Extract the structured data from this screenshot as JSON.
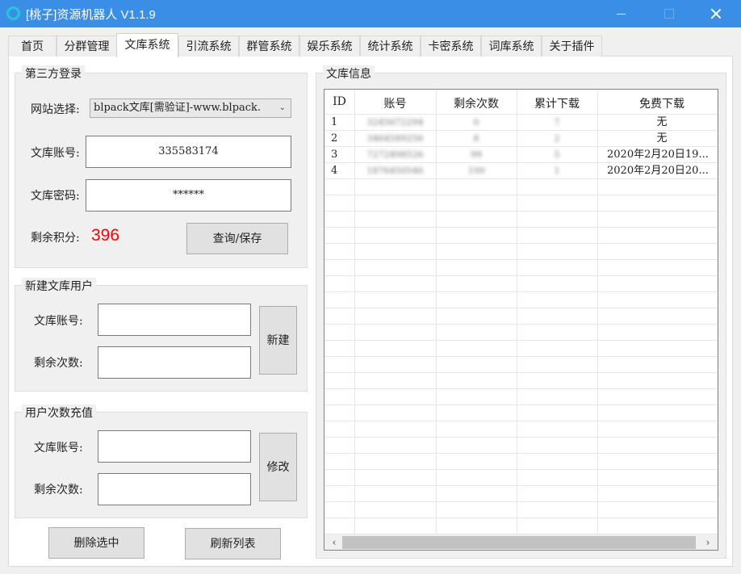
{
  "window": {
    "title": "[桃子]资源机器人 V1.1.9",
    "accent": "#3a8ee6"
  },
  "tabs": [
    {
      "label": "首页"
    },
    {
      "label": "分群管理"
    },
    {
      "label": "文库系统",
      "active": true
    },
    {
      "label": "引流系统"
    },
    {
      "label": "群管系统"
    },
    {
      "label": "娱乐系统"
    },
    {
      "label": "统计系统"
    },
    {
      "label": "卡密系统"
    },
    {
      "label": "词库系统"
    },
    {
      "label": "关于插件"
    }
  ],
  "login": {
    "title": "第三方登录",
    "site_label": "网站选择:",
    "site_value": "blpack文库[需验证]-www.blpack.",
    "account_label": "文库账号:",
    "account_value": "335583174",
    "password_label": "文库密码:",
    "password_value": "******",
    "points_label": "剩余积分:",
    "points_value": "396",
    "points_color": "#ff0000",
    "query_button": "查询/保存"
  },
  "new_user": {
    "title": "新建文库用户",
    "account_label": "文库账号:",
    "account_value": "",
    "count_label": "剩余次数:",
    "count_value": "",
    "create_button": "新建"
  },
  "recharge": {
    "title": "用户次数充值",
    "account_label": "文库账号:",
    "account_value": "",
    "count_label": "剩余次数:",
    "count_value": "",
    "modify_button": "修改"
  },
  "actions": {
    "delete_selected": "删除选中",
    "refresh_list": "刷新列表"
  },
  "info": {
    "title": "文库信息",
    "columns": [
      "ID",
      "账号",
      "剩余次数",
      "累计下载",
      "免费下载"
    ],
    "rows": [
      [
        "1",
        "3245672294",
        "0",
        "7",
        "无"
      ],
      [
        "2",
        "3464589256",
        "8",
        "2",
        "无"
      ],
      [
        "3",
        "7272498526",
        "99",
        "5",
        "2020年2月20日19..."
      ],
      [
        "4",
        "1876450546",
        "199",
        "1",
        "2020年2月20日20..."
      ]
    ]
  }
}
